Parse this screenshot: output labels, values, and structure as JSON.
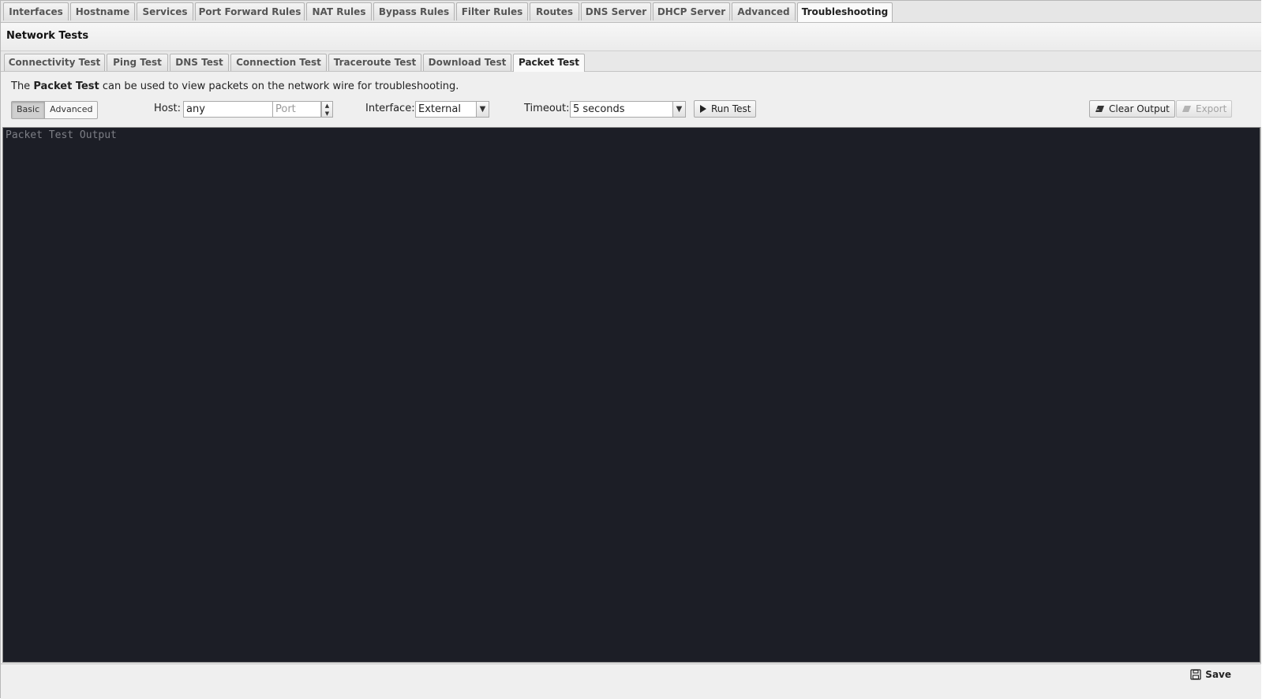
{
  "top_tabs": [
    {
      "label": "Interfaces"
    },
    {
      "label": "Hostname"
    },
    {
      "label": "Services"
    },
    {
      "label": "Port Forward Rules"
    },
    {
      "label": "NAT Rules"
    },
    {
      "label": "Bypass Rules"
    },
    {
      "label": "Filter Rules"
    },
    {
      "label": "Routes"
    },
    {
      "label": "DNS Server"
    },
    {
      "label": "DHCP Server"
    },
    {
      "label": "Advanced"
    },
    {
      "label": "Troubleshooting"
    }
  ],
  "active_top_tab": "Troubleshooting",
  "section_title": "Network Tests",
  "sub_tabs": [
    {
      "label": "Connectivity Test"
    },
    {
      "label": "Ping Test"
    },
    {
      "label": "DNS Test"
    },
    {
      "label": "Connection Test"
    },
    {
      "label": "Traceroute Test"
    },
    {
      "label": "Download Test"
    },
    {
      "label": "Packet Test"
    }
  ],
  "active_sub_tab": "Packet Test",
  "description": {
    "prefix": "The ",
    "bold": "Packet Test",
    "suffix": " can be used to view packets on the network wire for troubleshooting."
  },
  "mode_toggle": {
    "basic": "Basic",
    "advanced": "Advanced",
    "selected": "Basic"
  },
  "host": {
    "label": "Host:",
    "value": "any"
  },
  "port": {
    "placeholder": "Port"
  },
  "interface": {
    "label": "Interface:",
    "value": "External"
  },
  "timeout": {
    "label": "Timeout:",
    "value": "5 seconds"
  },
  "buttons": {
    "run_test": "Run Test",
    "clear_output": "Clear Output",
    "export": "Export"
  },
  "output": {
    "placeholder": "Packet Test Output"
  },
  "footer": {
    "save": "Save"
  },
  "colors": {
    "console_bg": "#1c1e26",
    "console_placeholder": "#7d7f86"
  }
}
